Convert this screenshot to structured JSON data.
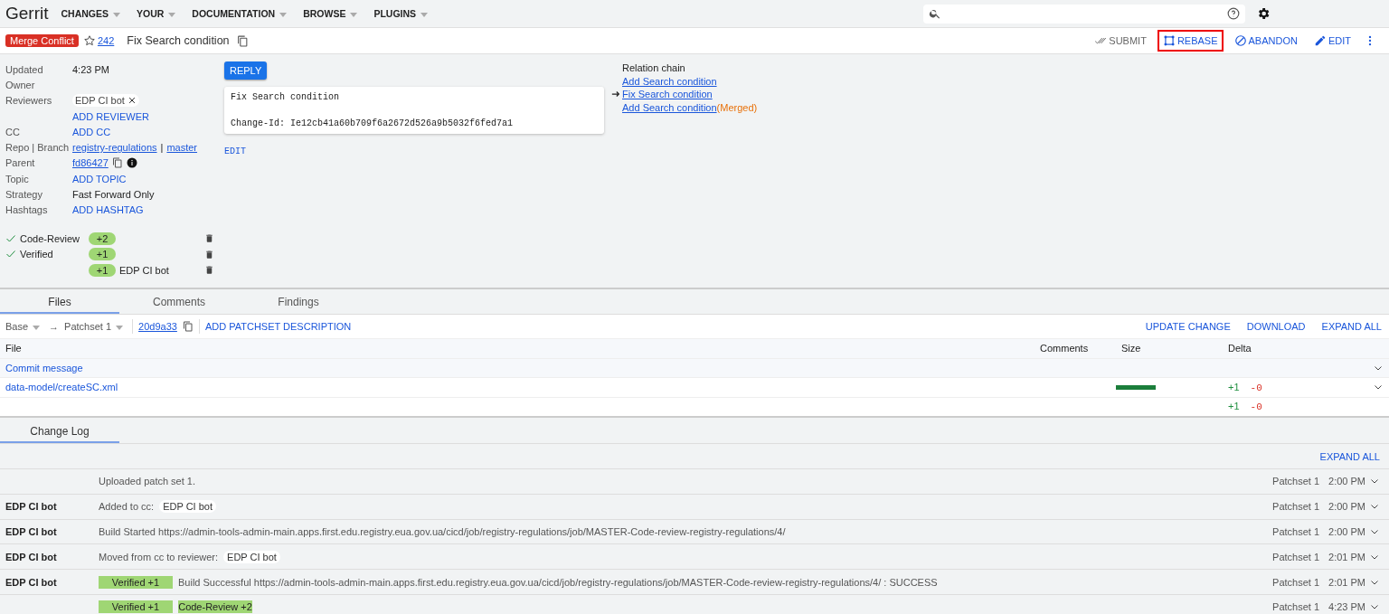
{
  "header": {
    "logo": "Gerrit",
    "nav": [
      "CHANGES",
      "YOUR",
      "DOCUMENTATION",
      "BROWSE",
      "PLUGINS"
    ]
  },
  "change": {
    "status": "Merge Conflict",
    "number": "242",
    "subject": "Fix Search condition",
    "actions": [
      {
        "label": "SUBMIT",
        "kind": "submit",
        "disabled": true,
        "highlighted": false
      },
      {
        "label": "REBASE",
        "kind": "rebase",
        "disabled": false,
        "highlighted": true
      },
      {
        "label": "ABANDON",
        "kind": "abandon",
        "disabled": false,
        "highlighted": false
      },
      {
        "label": "EDIT",
        "kind": "edit",
        "disabled": false,
        "highlighted": false
      }
    ]
  },
  "metadata": [
    {
      "label": "Updated",
      "values": [
        {
          "kind": "text",
          "text": "4:23 PM"
        }
      ]
    },
    {
      "label": "Owner"
    },
    {
      "label": "Reviewers",
      "values": [
        {
          "kind": "chip",
          "text": "EDP CI bot"
        }
      ]
    },
    {
      "values": [
        {
          "kind": "action",
          "text": "ADD REVIEWER"
        }
      ]
    },
    {
      "label": "CC",
      "values": [
        {
          "kind": "action",
          "text": "ADD CC"
        }
      ]
    },
    {
      "label": "Repo | Branch",
      "values": [
        {
          "kind": "link",
          "text": "registry-regulations"
        },
        {
          "kind": "text",
          "text": "|"
        },
        {
          "kind": "link",
          "text": "master"
        }
      ]
    },
    {
      "label": "Parent",
      "values": [
        {
          "kind": "link",
          "text": "fd86427"
        },
        {
          "kind": "copy"
        },
        {
          "kind": "info"
        }
      ]
    },
    {
      "label": "Topic",
      "values": [
        {
          "kind": "action",
          "text": "ADD TOPIC"
        }
      ]
    },
    {
      "label": "Strategy",
      "values": [
        {
          "kind": "text",
          "text": "Fast Forward Only"
        }
      ]
    },
    {
      "label": "Hashtags",
      "values": [
        {
          "kind": "action",
          "text": "ADD HASHTAG"
        }
      ]
    }
  ],
  "votes": [
    {
      "name": "Code-Review",
      "approved": true,
      "vote": "+2"
    },
    {
      "name": "Verified",
      "approved": true,
      "vote": "+1"
    },
    {
      "approved": false,
      "vote": "+1",
      "account": "EDP CI bot"
    }
  ],
  "reply_button": "REPLY",
  "commit_message": [
    "Fix Search condition",
    "Change-Id: Ie12cb41a60b709f6a2672d526a9b5032f6fed7a1"
  ],
  "commit_edit": "EDIT",
  "relation_chain": {
    "title": "Relation chain",
    "items": [
      {
        "text": "Add Search condition",
        "current": false
      },
      {
        "text": "Fix Search condition",
        "current": true
      },
      {
        "text": "Add Search condition",
        "current": false,
        "tag": "(Merged)"
      }
    ]
  },
  "tabs": [
    {
      "label": "Files",
      "selected": true
    },
    {
      "label": "Comments",
      "selected": false
    },
    {
      "label": "Findings",
      "selected": false
    }
  ],
  "patchset_bar": {
    "base": "Base",
    "arrow": "→",
    "patchset": "Patchset 1",
    "commit": "20d9a33",
    "add_description": "ADD PATCHSET DESCRIPTION",
    "actions": [
      "UPDATE CHANGE",
      "DOWNLOAD",
      "EXPAND ALL"
    ]
  },
  "files": {
    "columns": [
      "File",
      "Comments",
      "Size",
      "Delta"
    ],
    "rows": [
      {
        "kind": "commit",
        "name": "Commit message"
      },
      {
        "kind": "file",
        "name": "data-model/createSC.xml",
        "added": "+1",
        "removed": "-0"
      },
      {
        "kind": "total",
        "added": "+1",
        "removed": "-0"
      }
    ]
  },
  "change_log": {
    "tab": "Change Log",
    "expand_all": "EXPAND ALL",
    "entries": [
      {
        "message": "Uploaded patch set 1.",
        "patchset": "Patchset 1",
        "time": "2:00 PM"
      },
      {
        "author": "EDP CI bot",
        "message": "Added to cc:",
        "account": "EDP CI bot",
        "patchset": "Patchset 1",
        "time": "2:00 PM"
      },
      {
        "author": "EDP CI bot",
        "message": "Build Started https://admin-tools-admin-main.apps.first.edu.registry.eua.gov.ua/cicd/job/registry-regulations/job/MASTER-Code-review-registry-regulations/4/",
        "patchset": "Patchset 1",
        "time": "2:00 PM"
      },
      {
        "author": "EDP CI bot",
        "message": "Moved from cc to reviewer:",
        "account": "EDP CI bot",
        "patchset": "Patchset 1",
        "time": "2:01 PM"
      },
      {
        "author": "EDP CI bot",
        "chips": [
          "Verified +1"
        ],
        "message": "Build Successful https://admin-tools-admin-main.apps.first.edu.registry.eua.gov.ua/cicd/job/registry-regulations/job/MASTER-Code-review-registry-regulations/4/ : SUCCESS",
        "patchset": "Patchset 1",
        "time": "2:01 PM"
      },
      {
        "chips": [
          "Verified +1",
          "Code-Review +2"
        ],
        "patchset": "Patchset 1",
        "time": "4:23 PM"
      }
    ]
  }
}
